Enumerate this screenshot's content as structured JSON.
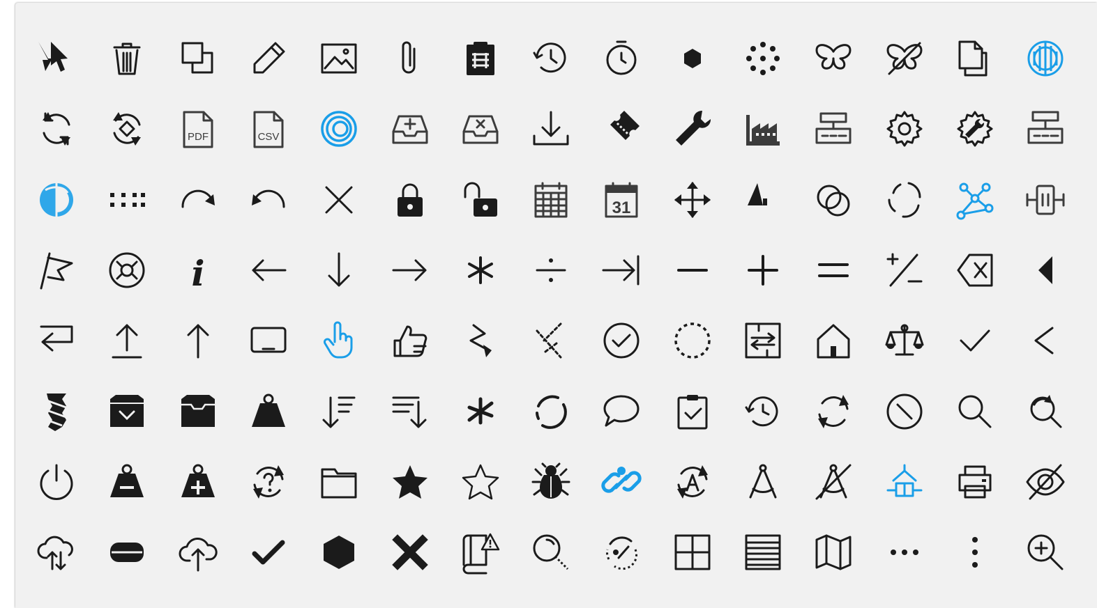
{
  "colors": {
    "ink": "#1b1b1b",
    "accent": "#1a9ee8",
    "panel_bg": "#f1f1f1"
  },
  "icons": {
    "r1": [
      "select-cursor",
      "trash",
      "copy",
      "pencil",
      "image",
      "paperclip",
      "clipboard-list",
      "history",
      "timer",
      "hexagon-small",
      "dots-circle",
      "butterfly",
      "butterfly-off",
      "files",
      "tire"
    ],
    "r2": [
      "sync",
      "sync-diamond",
      "pdf-file",
      "csv-file",
      "rings",
      "tray-add",
      "tray-remove",
      "download",
      "ticket",
      "wrench",
      "factory",
      "network-rack",
      "gear",
      "gear-wrench",
      "network-rack-2"
    ],
    "r3": [
      "orbit-3d",
      "dots-grid",
      "redo",
      "undo",
      "close",
      "lock",
      "lock-open",
      "calendar",
      "calendar-31",
      "move",
      "shapes",
      "link-circles",
      "loading",
      "graph-nodes",
      "resize-horizontal"
    ],
    "r4": [
      "flag",
      "disc",
      "info",
      "arrow-left",
      "arrow-down",
      "arrow-right",
      "multiply",
      "divide",
      "tab-right",
      "minus",
      "plus",
      "equals",
      "plus-minus",
      "backspace",
      "caret-left"
    ],
    "r5": [
      "return",
      "upload",
      "arrow-up",
      "laptop",
      "hand-pointer",
      "thumb-up",
      "zap",
      "scatter",
      "check-circle",
      "dashed-circle",
      "compare",
      "home",
      "scale",
      "check",
      "chevron-left"
    ],
    "r6": [
      "drill-bit",
      "archive-check",
      "archive",
      "weight",
      "sort-down",
      "sort-down-2",
      "asterisk",
      "loading-ring",
      "speech-bubble",
      "clipboard-check",
      "clock-back",
      "refresh",
      "no-entry",
      "search",
      "search-refresh"
    ],
    "r7": [
      "power",
      "weight-minus",
      "weight-plus",
      "help-refresh",
      "folder",
      "star",
      "star-outline",
      "bug",
      "link-blue",
      "auto-refresh",
      "compass",
      "compass-off",
      "hierarchy",
      "printer",
      "eye-off"
    ],
    "r8": [
      "cloud-sync",
      "pill-flat",
      "cloud-upload",
      "checkmark",
      "hexagon",
      "x-bold",
      "book-alert",
      "magnifier-dashed",
      "dashed-sync",
      "grid-2x2",
      "table-rows",
      "map",
      "dots-horizontal",
      "dots-vertical",
      "zoom-in"
    ]
  },
  "text": {
    "pdf": "PDF",
    "csv": "CSV",
    "cal31": "31",
    "info": "i"
  }
}
